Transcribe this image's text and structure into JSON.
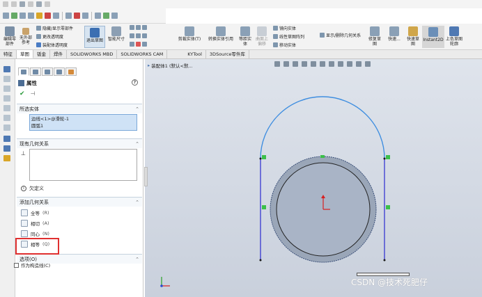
{
  "ribbon": {
    "edit_component": "编辑零部件",
    "no_external_ref": "无外部参考",
    "hide_show_components": "隐藏/显示零部件",
    "change_transparency": "更改透明度",
    "assembly_transparency": "装配体透明度",
    "exit_sketch": "退出草图",
    "smart_dimension": "智能尺寸",
    "trim_entities": "剪裁实体(T)",
    "convert_entities": "转换实体引用",
    "offset_entities": "等距实体",
    "offset_on_surface": "曲面上偏移",
    "mirror_entities": "镜向实体",
    "linear_pattern": "线性草图阵列",
    "move_entities": "移动实体",
    "display_delete_relations": "显示/删除几何关系",
    "repair_sketch": "修复草图",
    "quick_snaps": "快速...",
    "rapid_sketch": "快速草图",
    "instant2d": "Instant2D",
    "shaded_sketch": "上色草图轮廓"
  },
  "tabs": [
    "特征",
    "草图",
    "钣金",
    "焊件",
    "SOLIDWORKS MBD",
    "SOLIDWORKS CAM",
    "KYTool",
    "3DSource零件库"
  ],
  "property_manager": {
    "title": "属性",
    "help": "?",
    "selected_entities_header": "所选实体",
    "selected_entities": [
      "边线<1>@滑轮-1",
      "圆弧1"
    ],
    "existing_relations_header": "现有几何关系",
    "status": "欠定义",
    "add_relations_header": "添加几何关系",
    "relations": [
      {
        "label": "全等",
        "shortcut": "(R)"
      },
      {
        "label": "相切",
        "shortcut": "(A)"
      },
      {
        "label": "同心",
        "shortcut": "(N)"
      },
      {
        "label": "相等",
        "shortcut": "(Q)"
      }
    ],
    "options_header": "选项(O)",
    "construction_label": "作为构造线(C)"
  },
  "viewport": {
    "title": "装配体1 (默认<默...",
    "watermark": "CSDN @技术死肥仔"
  },
  "colors": {
    "accent": "#4f79b3",
    "arc": "#3f8ee0",
    "line": "#2a2ad0",
    "highlight": "#e03030"
  }
}
